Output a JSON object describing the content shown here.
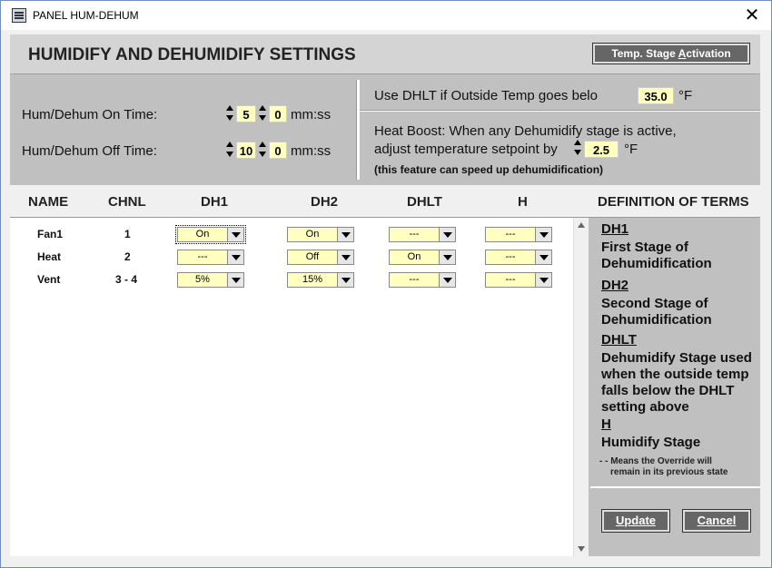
{
  "window": {
    "title": "PANEL HUM-DEHUM",
    "close_glyph": "✕"
  },
  "header": {
    "title": "HUMIDIFY AND DEHUMIDIFY SETTINGS",
    "stage_btn_pre": "Temp. Stage ",
    "stage_btn_u": "A",
    "stage_btn_post": "ctivation"
  },
  "times": {
    "on_label": "Hum/Dehum On Time:",
    "on_min": "5",
    "on_sec": "0",
    "off_label": "Hum/Dehum Off Time:",
    "off_min": "10",
    "off_sec": "0",
    "unit": "mm:ss"
  },
  "dhlt": {
    "label": "Use DHLT if Outside Temp goes belo",
    "value": "35.0",
    "unit": "°F"
  },
  "boost": {
    "line1": "Heat Boost:  When any Dehumidify stage is active,",
    "line2": "adjust temperature setpoint by",
    "value": "2.5",
    "unit": "°F",
    "note": "(this feature can speed up dehumidification)"
  },
  "columns": {
    "name": "NAME",
    "chnl": "CHNL",
    "dh1": "DH1",
    "dh2": "DH2",
    "dhlt": "DHLT",
    "h": "H",
    "defs": "DEFINITION OF TERMS"
  },
  "rows": [
    {
      "name": "Fan1",
      "chnl": "1",
      "dh1": "On",
      "dh2": "On",
      "dhlt": "---",
      "h": "---"
    },
    {
      "name": "Heat",
      "chnl": "2",
      "dh1": "---",
      "dh2": "Off",
      "dhlt": "On",
      "h": "---"
    },
    {
      "name": "Vent",
      "chnl": "3 -  4",
      "dh1": "5%",
      "dh2": "15%",
      "dhlt": "---",
      "h": "---"
    }
  ],
  "defs": {
    "dh1_k": "DH1",
    "dh1_a": "First Stage of",
    "dh1_b": "Dehumidification",
    "dh2_k": "DH2",
    "dh2_a": "Second Stage of",
    "dh2_b": "Dehumidification",
    "dhlt_k": "DHLT",
    "dhlt_a": "Dehumidify Stage used",
    "dhlt_b": "when the outside temp",
    "dhlt_c": "falls below the DHLT",
    "dhlt_d": "setting above",
    "h_k": "H",
    "h_a": "Humidify Stage",
    "note_a": "- - Means the Override will",
    "note_b": "remain in its previous state"
  },
  "buttons": {
    "update_u": "U",
    "update_rest": "pdate",
    "cancel_u": "C",
    "cancel_rest": "ancel"
  }
}
